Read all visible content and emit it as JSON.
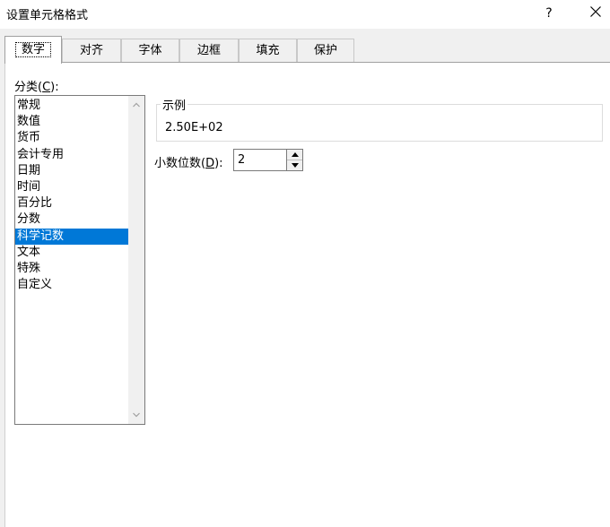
{
  "window": {
    "title": "设置单元格格式",
    "help_label": "?",
    "close_icon": "close-icon"
  },
  "tabs": [
    {
      "label": "数字",
      "active": true
    },
    {
      "label": "对齐"
    },
    {
      "label": "字体"
    },
    {
      "label": "边框"
    },
    {
      "label": "填充"
    },
    {
      "label": "保护"
    }
  ],
  "category": {
    "label_text": "分类(",
    "label_accel": "C",
    "label_tail": "):",
    "items": [
      "常规",
      "数值",
      "货币",
      "会计专用",
      "日期",
      "时间",
      "百分比",
      "分数",
      "科学记数",
      "文本",
      "特殊",
      "自定义"
    ],
    "selected": "科学记数"
  },
  "sample": {
    "title": "示例",
    "value": "2.50E+02"
  },
  "decimals": {
    "label_text": "小数位数(",
    "label_accel": "D",
    "label_tail": "):",
    "value": "2"
  },
  "colors": {
    "selection": "#0078d7",
    "background": "#f0f0f0"
  }
}
